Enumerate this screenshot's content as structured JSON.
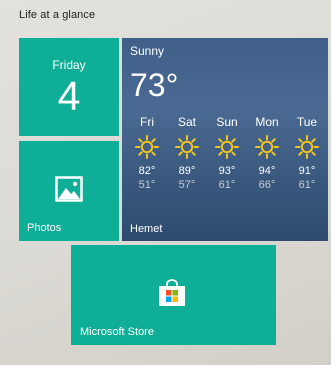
{
  "group": {
    "title": "Life at a glance"
  },
  "calendar": {
    "day_name": "Friday",
    "day_number": "4",
    "icon": "calendar-icon"
  },
  "photos": {
    "label": "Photos",
    "icon": "photos-icon"
  },
  "weather": {
    "condition": "Sunny",
    "current_temp": "73°",
    "location": "Hemet",
    "forecast": [
      {
        "day": "Fri",
        "icon": "sun-icon",
        "high": "82°",
        "low": "51°"
      },
      {
        "day": "Sat",
        "icon": "sun-icon",
        "high": "89°",
        "low": "57°"
      },
      {
        "day": "Sun",
        "icon": "sun-icon",
        "high": "93°",
        "low": "61°"
      },
      {
        "day": "Mon",
        "icon": "sun-icon",
        "high": "94°",
        "low": "66°"
      },
      {
        "day": "Tue",
        "icon": "sun-icon",
        "high": "91°",
        "low": "61°"
      }
    ]
  },
  "store": {
    "label": "Microsoft Store",
    "icon": "store-bag-icon"
  },
  "colors": {
    "tile_teal": "#0fae96",
    "weather_bg": "#3f5f89",
    "sun": "#f3c51c",
    "store_red": "#f25022",
    "store_green": "#7fba00",
    "store_blue": "#00a4ef",
    "store_yellow": "#ffb900"
  }
}
